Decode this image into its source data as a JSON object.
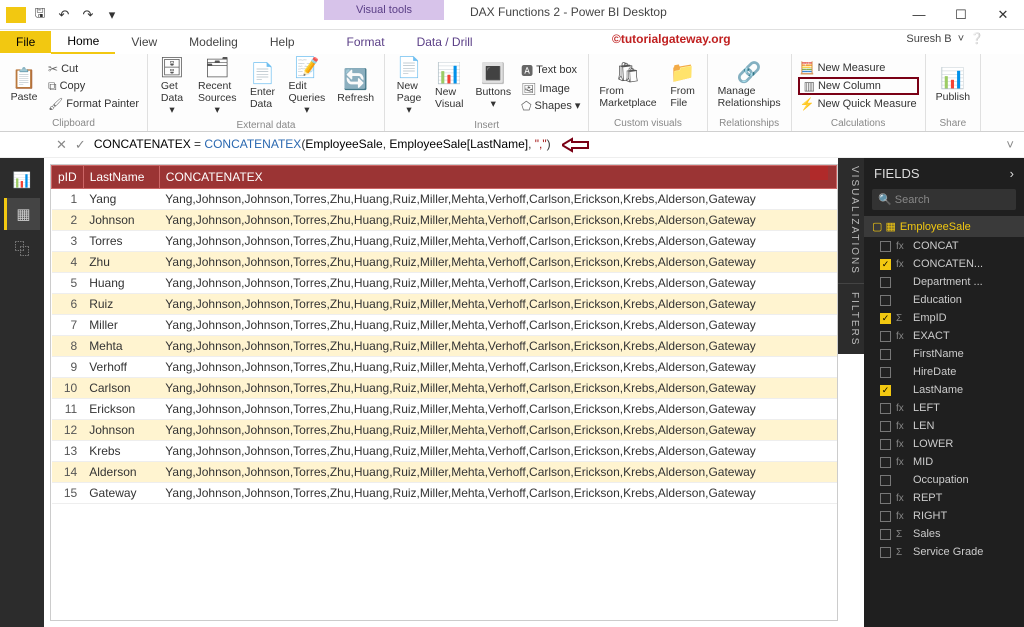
{
  "titlebar": {
    "title": "DAX Functions 2 - Power BI Desktop",
    "visual_tools": "Visual tools",
    "user": "Suresh B",
    "watermark": "©tutorialgateway.org"
  },
  "menu": {
    "file": "File",
    "home": "Home",
    "view": "View",
    "modeling": "Modeling",
    "help": "Help",
    "format": "Format",
    "datadrill": "Data / Drill"
  },
  "ribbon": {
    "clip": {
      "paste": "Paste",
      "cut": "Cut",
      "copy": "Copy",
      "painter": "Format Painter",
      "group": "Clipboard"
    },
    "ext": {
      "get": "Get\nData",
      "recent": "Recent\nSources",
      "enter": "Enter\nData",
      "edit": "Edit\nQueries",
      "refresh": "Refresh",
      "group": "External data"
    },
    "insert": {
      "page": "New\nPage",
      "visual": "New\nVisual",
      "buttons": "Buttons",
      "textbox": "Text box",
      "image": "Image",
      "shapes": "Shapes",
      "group": "Insert"
    },
    "custom": {
      "market": "From\nMarketplace",
      "file": "From\nFile",
      "group": "Custom visuals"
    },
    "rel": {
      "manage": "Manage\nRelationships",
      "group": "Relationships"
    },
    "calc": {
      "measure": "New Measure",
      "column": "New Column",
      "quick": "New Quick Measure",
      "group": "Calculations"
    },
    "share": {
      "publish": "Publish",
      "group": "Share"
    }
  },
  "formula": {
    "name": "CONCATENATEX",
    "eq": " = ",
    "func": "CONCATENATEX",
    "open": "(",
    "a1": "EmployeeSale",
    "c1": ", ",
    "a2": "EmployeeSale[LastName]",
    "c2": ", ",
    "s": "\",\"",
    "close": ")"
  },
  "columns": {
    "id": "pID",
    "last": "LastName",
    "conc": "CONCATENATEX"
  },
  "concat_value": "Yang,Johnson,Johnson,Torres,Zhu,Huang,Ruiz,Miller,Mehta,Verhoff,Carlson,Erickson,Krebs,Alderson,Gateway",
  "rows": [
    {
      "i": "1",
      "ln": "Yang"
    },
    {
      "i": "2",
      "ln": "Johnson"
    },
    {
      "i": "3",
      "ln": "Torres"
    },
    {
      "i": "4",
      "ln": "Zhu"
    },
    {
      "i": "5",
      "ln": "Huang"
    },
    {
      "i": "6",
      "ln": "Ruiz"
    },
    {
      "i": "7",
      "ln": "Miller"
    },
    {
      "i": "8",
      "ln": "Mehta"
    },
    {
      "i": "9",
      "ln": "Verhoff"
    },
    {
      "i": "10",
      "ln": "Carlson"
    },
    {
      "i": "11",
      "ln": "Erickson"
    },
    {
      "i": "12",
      "ln": "Johnson"
    },
    {
      "i": "13",
      "ln": "Krebs"
    },
    {
      "i": "14",
      "ln": "Alderson"
    },
    {
      "i": "15",
      "ln": "Gateway"
    }
  ],
  "fields": {
    "title": "FIELDS",
    "search": "Search",
    "table": "EmployeeSale",
    "items": [
      {
        "n": "CONCAT",
        "ic": "fx",
        "sel": false
      },
      {
        "n": "CONCATEN...",
        "ic": "fx",
        "sel": true
      },
      {
        "n": "Department ...",
        "ic": "",
        "sel": false
      },
      {
        "n": "Education",
        "ic": "",
        "sel": false
      },
      {
        "n": "EmpID",
        "ic": "Σ",
        "sel": true
      },
      {
        "n": "EXACT",
        "ic": "fx",
        "sel": false
      },
      {
        "n": "FirstName",
        "ic": "",
        "sel": false
      },
      {
        "n": "HireDate",
        "ic": "",
        "sel": false
      },
      {
        "n": "LastName",
        "ic": "",
        "sel": true
      },
      {
        "n": "LEFT",
        "ic": "fx",
        "sel": false
      },
      {
        "n": "LEN",
        "ic": "fx",
        "sel": false
      },
      {
        "n": "LOWER",
        "ic": "fx",
        "sel": false
      },
      {
        "n": "MID",
        "ic": "fx",
        "sel": false
      },
      {
        "n": "Occupation",
        "ic": "",
        "sel": false
      },
      {
        "n": "REPT",
        "ic": "fx",
        "sel": false
      },
      {
        "n": "RIGHT",
        "ic": "fx",
        "sel": false
      },
      {
        "n": "Sales",
        "ic": "Σ",
        "sel": false
      },
      {
        "n": "Service Grade",
        "ic": "Σ",
        "sel": false
      }
    ]
  },
  "panels": {
    "viz": "VISUALIZATIONS",
    "filters": "FILTERS"
  }
}
